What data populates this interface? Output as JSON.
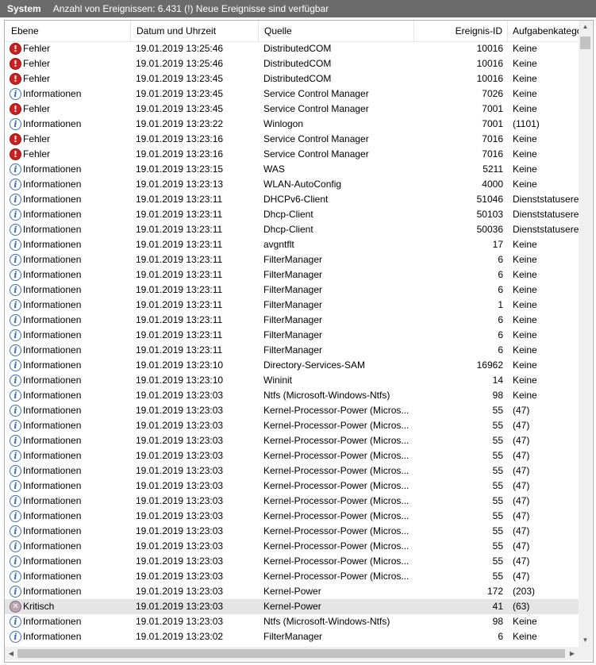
{
  "header": {
    "title": "System",
    "count_text": "Anzahl von Ereignissen: 6.431 (!) Neue Ereignisse sind verfügbar"
  },
  "columns": [
    "Ebene",
    "Datum und Uhrzeit",
    "Quelle",
    "Ereignis-ID",
    "Aufgabenkategorie"
  ],
  "colors": {
    "header_bar": "#6b6b6b",
    "selected_row": "#e5e5e5",
    "error_icon": "#cc1f1f",
    "info_icon": "#3a6fb0"
  },
  "rows": [
    {
      "level": "Fehler",
      "icon": "error-icon",
      "date": "19.01.2019 13:25:46",
      "source": "DistributedCOM",
      "id": "10016",
      "task": "Keine"
    },
    {
      "level": "Fehler",
      "icon": "error-icon",
      "date": "19.01.2019 13:25:46",
      "source": "DistributedCOM",
      "id": "10016",
      "task": "Keine"
    },
    {
      "level": "Fehler",
      "icon": "error-icon",
      "date": "19.01.2019 13:23:45",
      "source": "DistributedCOM",
      "id": "10016",
      "task": "Keine"
    },
    {
      "level": "Informationen",
      "icon": "info-icon",
      "date": "19.01.2019 13:23:45",
      "source": "Service Control Manager",
      "id": "7026",
      "task": "Keine"
    },
    {
      "level": "Fehler",
      "icon": "error-icon",
      "date": "19.01.2019 13:23:45",
      "source": "Service Control Manager",
      "id": "7001",
      "task": "Keine"
    },
    {
      "level": "Informationen",
      "icon": "info-icon",
      "date": "19.01.2019 13:23:22",
      "source": "Winlogon",
      "id": "7001",
      "task": "(1101)"
    },
    {
      "level": "Fehler",
      "icon": "error-icon",
      "date": "19.01.2019 13:23:16",
      "source": "Service Control Manager",
      "id": "7016",
      "task": "Keine"
    },
    {
      "level": "Fehler",
      "icon": "error-icon",
      "date": "19.01.2019 13:23:16",
      "source": "Service Control Manager",
      "id": "7016",
      "task": "Keine"
    },
    {
      "level": "Informationen",
      "icon": "info-icon",
      "date": "19.01.2019 13:23:15",
      "source": "WAS",
      "id": "5211",
      "task": "Keine"
    },
    {
      "level": "Informationen",
      "icon": "info-icon",
      "date": "19.01.2019 13:23:13",
      "source": "WLAN-AutoConfig",
      "id": "4000",
      "task": "Keine"
    },
    {
      "level": "Informationen",
      "icon": "info-icon",
      "date": "19.01.2019 13:23:11",
      "source": "DHCPv6-Client",
      "id": "51046",
      "task": "Dienststatuserei"
    },
    {
      "level": "Informationen",
      "icon": "info-icon",
      "date": "19.01.2019 13:23:11",
      "source": "Dhcp-Client",
      "id": "50103",
      "task": "Dienststatuserei"
    },
    {
      "level": "Informationen",
      "icon": "info-icon",
      "date": "19.01.2019 13:23:11",
      "source": "Dhcp-Client",
      "id": "50036",
      "task": "Dienststatuserei"
    },
    {
      "level": "Informationen",
      "icon": "info-icon",
      "date": "19.01.2019 13:23:11",
      "source": "avgntflt",
      "id": "17",
      "task": "Keine"
    },
    {
      "level": "Informationen",
      "icon": "info-icon",
      "date": "19.01.2019 13:23:11",
      "source": "FilterManager",
      "id": "6",
      "task": "Keine"
    },
    {
      "level": "Informationen",
      "icon": "info-icon",
      "date": "19.01.2019 13:23:11",
      "source": "FilterManager",
      "id": "6",
      "task": "Keine"
    },
    {
      "level": "Informationen",
      "icon": "info-icon",
      "date": "19.01.2019 13:23:11",
      "source": "FilterManager",
      "id": "6",
      "task": "Keine"
    },
    {
      "level": "Informationen",
      "icon": "info-icon",
      "date": "19.01.2019 13:23:11",
      "source": "FilterManager",
      "id": "1",
      "task": "Keine"
    },
    {
      "level": "Informationen",
      "icon": "info-icon",
      "date": "19.01.2019 13:23:11",
      "source": "FilterManager",
      "id": "6",
      "task": "Keine"
    },
    {
      "level": "Informationen",
      "icon": "info-icon",
      "date": "19.01.2019 13:23:11",
      "source": "FilterManager",
      "id": "6",
      "task": "Keine"
    },
    {
      "level": "Informationen",
      "icon": "info-icon",
      "date": "19.01.2019 13:23:11",
      "source": "FilterManager",
      "id": "6",
      "task": "Keine"
    },
    {
      "level": "Informationen",
      "icon": "info-icon",
      "date": "19.01.2019 13:23:10",
      "source": "Directory-Services-SAM",
      "id": "16962",
      "task": "Keine"
    },
    {
      "level": "Informationen",
      "icon": "info-icon",
      "date": "19.01.2019 13:23:10",
      "source": "Wininit",
      "id": "14",
      "task": "Keine"
    },
    {
      "level": "Informationen",
      "icon": "info-icon",
      "date": "19.01.2019 13:23:03",
      "source": "Ntfs (Microsoft-Windows-Ntfs)",
      "id": "98",
      "task": "Keine"
    },
    {
      "level": "Informationen",
      "icon": "info-icon",
      "date": "19.01.2019 13:23:03",
      "source": "Kernel-Processor-Power (Micros...",
      "id": "55",
      "task": "(47)"
    },
    {
      "level": "Informationen",
      "icon": "info-icon",
      "date": "19.01.2019 13:23:03",
      "source": "Kernel-Processor-Power (Micros...",
      "id": "55",
      "task": "(47)"
    },
    {
      "level": "Informationen",
      "icon": "info-icon",
      "date": "19.01.2019 13:23:03",
      "source": "Kernel-Processor-Power (Micros...",
      "id": "55",
      "task": "(47)"
    },
    {
      "level": "Informationen",
      "icon": "info-icon",
      "date": "19.01.2019 13:23:03",
      "source": "Kernel-Processor-Power (Micros...",
      "id": "55",
      "task": "(47)"
    },
    {
      "level": "Informationen",
      "icon": "info-icon",
      "date": "19.01.2019 13:23:03",
      "source": "Kernel-Processor-Power (Micros...",
      "id": "55",
      "task": "(47)"
    },
    {
      "level": "Informationen",
      "icon": "info-icon",
      "date": "19.01.2019 13:23:03",
      "source": "Kernel-Processor-Power (Micros...",
      "id": "55",
      "task": "(47)"
    },
    {
      "level": "Informationen",
      "icon": "info-icon",
      "date": "19.01.2019 13:23:03",
      "source": "Kernel-Processor-Power (Micros...",
      "id": "55",
      "task": "(47)"
    },
    {
      "level": "Informationen",
      "icon": "info-icon",
      "date": "19.01.2019 13:23:03",
      "source": "Kernel-Processor-Power (Micros...",
      "id": "55",
      "task": "(47)"
    },
    {
      "level": "Informationen",
      "icon": "info-icon",
      "date": "19.01.2019 13:23:03",
      "source": "Kernel-Processor-Power (Micros...",
      "id": "55",
      "task": "(47)"
    },
    {
      "level": "Informationen",
      "icon": "info-icon",
      "date": "19.01.2019 13:23:03",
      "source": "Kernel-Processor-Power (Micros...",
      "id": "55",
      "task": "(47)"
    },
    {
      "level": "Informationen",
      "icon": "info-icon",
      "date": "19.01.2019 13:23:03",
      "source": "Kernel-Processor-Power (Micros...",
      "id": "55",
      "task": "(47)"
    },
    {
      "level": "Informationen",
      "icon": "info-icon",
      "date": "19.01.2019 13:23:03",
      "source": "Kernel-Processor-Power (Micros...",
      "id": "55",
      "task": "(47)"
    },
    {
      "level": "Informationen",
      "icon": "info-icon",
      "date": "19.01.2019 13:23:03",
      "source": "Kernel-Power",
      "id": "172",
      "task": "(203)"
    },
    {
      "level": "Kritisch",
      "icon": "critical-icon",
      "date": "19.01.2019 13:23:03",
      "source": "Kernel-Power",
      "id": "41",
      "task": "(63)",
      "selected": true
    },
    {
      "level": "Informationen",
      "icon": "info-icon",
      "date": "19.01.2019 13:23:03",
      "source": "Ntfs (Microsoft-Windows-Ntfs)",
      "id": "98",
      "task": "Keine"
    },
    {
      "level": "Informationen",
      "icon": "info-icon",
      "date": "19.01.2019 13:23:02",
      "source": "FilterManager",
      "id": "6",
      "task": "Keine"
    }
  ]
}
